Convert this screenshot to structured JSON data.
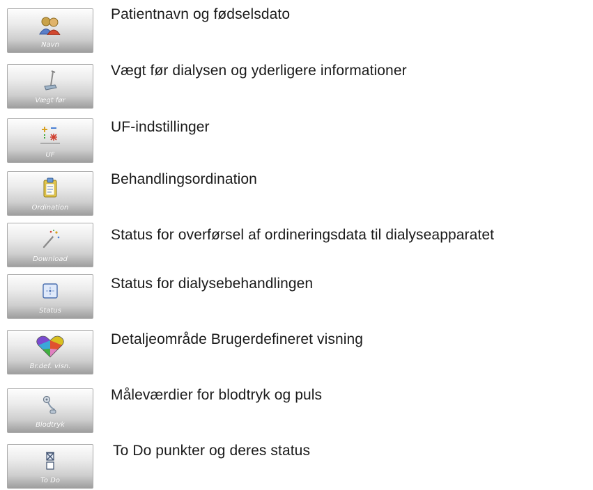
{
  "items": [
    {
      "button_label": "Navn",
      "icon": "two-persons-icon",
      "description": "Patientnavn og fødselsdato"
    },
    {
      "button_label": "Vægt før",
      "icon": "scale-icon",
      "description": "Vægt før dialysen og yderligere informationer"
    },
    {
      "button_label": "UF",
      "icon": "uf-icon",
      "description": "UF-indstillinger"
    },
    {
      "button_label": "Ordination",
      "icon": "clipboard-icon",
      "description": "Behandlingsordination"
    },
    {
      "button_label": "Download",
      "icon": "magic-wand-icon",
      "description": "Status for overførsel af ordineringsdata til dialyseapparatet"
    },
    {
      "button_label": "Status",
      "icon": "status-icon",
      "description": "Status for dialysebehandlingen"
    },
    {
      "button_label": "Br.def. visn.",
      "icon": "heart-icon",
      "description": "Detaljeområde Brugerdefineret visning"
    },
    {
      "button_label": "Blodtryk",
      "icon": "blood-pressure-icon",
      "description": "Måleværdier for blodtryk og puls"
    },
    {
      "button_label": "To Do",
      "icon": "todo-icon",
      "description": "To Do punkter og deres status"
    }
  ],
  "colors": {
    "button_label": "#ffffff",
    "description_text": "#1a1a1a",
    "accent_blue": "#4a7fd4",
    "accent_red": "#d04030"
  }
}
